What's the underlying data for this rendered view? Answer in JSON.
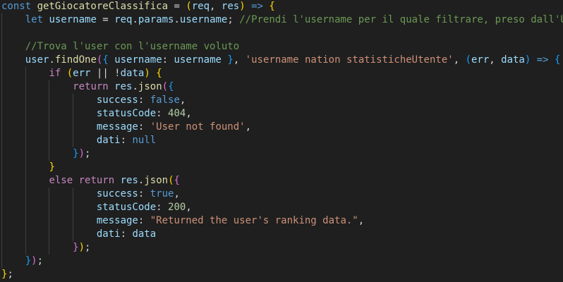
{
  "theme": {
    "background": "#1f1f1f",
    "indent_guide": "#404040"
  },
  "code_lines": [
    {
      "guides": 0,
      "tokens": [
        {
          "t": "const ",
          "c": "kw"
        },
        {
          "t": "getGiocatoreClassifica",
          "c": "fn"
        },
        {
          "t": " = ",
          "c": "plain"
        },
        {
          "t": "(",
          "c": "p1"
        },
        {
          "t": "req",
          "c": "var"
        },
        {
          "t": ", ",
          "c": "plain"
        },
        {
          "t": "res",
          "c": "var"
        },
        {
          "t": ")",
          "c": "p1"
        },
        {
          "t": " ",
          "c": "plain"
        },
        {
          "t": "=>",
          "c": "kw"
        },
        {
          "t": " ",
          "c": "plain"
        },
        {
          "t": "{",
          "c": "p1"
        }
      ]
    },
    {
      "guides": 1,
      "tokens": [
        {
          "t": "    ",
          "c": "plain"
        },
        {
          "t": "let ",
          "c": "kw"
        },
        {
          "t": "username",
          "c": "var"
        },
        {
          "t": " = ",
          "c": "plain"
        },
        {
          "t": "req",
          "c": "var"
        },
        {
          "t": ".",
          "c": "plain"
        },
        {
          "t": "params",
          "c": "var"
        },
        {
          "t": ".",
          "c": "plain"
        },
        {
          "t": "username",
          "c": "var"
        },
        {
          "t": "; ",
          "c": "plain"
        },
        {
          "t": "//Prendi l'username per il quale filtrare, preso dall'U",
          "c": "cmt"
        }
      ]
    },
    {
      "guides": 1,
      "tokens": []
    },
    {
      "guides": 1,
      "tokens": [
        {
          "t": "    ",
          "c": "plain"
        },
        {
          "t": "//Trova l'user con l'username voluto",
          "c": "cmt"
        }
      ]
    },
    {
      "guides": 1,
      "tokens": [
        {
          "t": "    ",
          "c": "plain"
        },
        {
          "t": "user",
          "c": "var"
        },
        {
          "t": ".",
          "c": "plain"
        },
        {
          "t": "findOne",
          "c": "fn"
        },
        {
          "t": "(",
          "c": "p2"
        },
        {
          "t": "{",
          "c": "p3"
        },
        {
          "t": " ",
          "c": "plain"
        },
        {
          "t": "username",
          "c": "var"
        },
        {
          "t": ": ",
          "c": "plain"
        },
        {
          "t": "username",
          "c": "var"
        },
        {
          "t": " ",
          "c": "plain"
        },
        {
          "t": "}",
          "c": "p3"
        },
        {
          "t": ", ",
          "c": "plain"
        },
        {
          "t": "'username nation statisticheUtente'",
          "c": "str"
        },
        {
          "t": ", ",
          "c": "plain"
        },
        {
          "t": "(",
          "c": "p3"
        },
        {
          "t": "err",
          "c": "var"
        },
        {
          "t": ", ",
          "c": "plain"
        },
        {
          "t": "data",
          "c": "var"
        },
        {
          "t": ")",
          "c": "p3"
        },
        {
          "t": " ",
          "c": "plain"
        },
        {
          "t": "=>",
          "c": "kw"
        },
        {
          "t": " ",
          "c": "plain"
        },
        {
          "t": "{",
          "c": "p3"
        }
      ]
    },
    {
      "guides": 2,
      "tokens": [
        {
          "t": "        ",
          "c": "plain"
        },
        {
          "t": "if",
          "c": "ctrl"
        },
        {
          "t": " ",
          "c": "plain"
        },
        {
          "t": "(",
          "c": "p1"
        },
        {
          "t": "err",
          "c": "var"
        },
        {
          "t": " || !",
          "c": "plain"
        },
        {
          "t": "data",
          "c": "var"
        },
        {
          "t": ")",
          "c": "p1"
        },
        {
          "t": " ",
          "c": "plain"
        },
        {
          "t": "{",
          "c": "p1"
        }
      ]
    },
    {
      "guides": 3,
      "tokens": [
        {
          "t": "            ",
          "c": "plain"
        },
        {
          "t": "return",
          "c": "ctrl"
        },
        {
          "t": " ",
          "c": "plain"
        },
        {
          "t": "res",
          "c": "var"
        },
        {
          "t": ".",
          "c": "plain"
        },
        {
          "t": "json",
          "c": "fn"
        },
        {
          "t": "(",
          "c": "p2"
        },
        {
          "t": "{",
          "c": "p3"
        }
      ]
    },
    {
      "guides": 4,
      "tokens": [
        {
          "t": "                ",
          "c": "plain"
        },
        {
          "t": "success",
          "c": "var"
        },
        {
          "t": ": ",
          "c": "plain"
        },
        {
          "t": "false",
          "c": "kw"
        },
        {
          "t": ",",
          "c": "plain"
        }
      ]
    },
    {
      "guides": 4,
      "tokens": [
        {
          "t": "                ",
          "c": "plain"
        },
        {
          "t": "statusCode",
          "c": "var"
        },
        {
          "t": ": ",
          "c": "plain"
        },
        {
          "t": "404",
          "c": "num"
        },
        {
          "t": ",",
          "c": "plain"
        }
      ]
    },
    {
      "guides": 4,
      "tokens": [
        {
          "t": "                ",
          "c": "plain"
        },
        {
          "t": "message",
          "c": "var"
        },
        {
          "t": ": ",
          "c": "plain"
        },
        {
          "t": "'User not found'",
          "c": "str"
        },
        {
          "t": ",",
          "c": "plain"
        }
      ]
    },
    {
      "guides": 4,
      "tokens": [
        {
          "t": "                ",
          "c": "plain"
        },
        {
          "t": "dati",
          "c": "var"
        },
        {
          "t": ": ",
          "c": "plain"
        },
        {
          "t": "null",
          "c": "kw"
        }
      ]
    },
    {
      "guides": 3,
      "tokens": [
        {
          "t": "            ",
          "c": "plain"
        },
        {
          "t": "}",
          "c": "p3"
        },
        {
          "t": ")",
          "c": "p2"
        },
        {
          "t": ";",
          "c": "plain"
        }
      ]
    },
    {
      "guides": 2,
      "tokens": [
        {
          "t": "        ",
          "c": "plain"
        },
        {
          "t": "}",
          "c": "p1"
        }
      ]
    },
    {
      "guides": 2,
      "tokens": [
        {
          "t": "        ",
          "c": "plain"
        },
        {
          "t": "else",
          "c": "ctrl"
        },
        {
          "t": " ",
          "c": "plain"
        },
        {
          "t": "return",
          "c": "ctrl"
        },
        {
          "t": " ",
          "c": "plain"
        },
        {
          "t": "res",
          "c": "var"
        },
        {
          "t": ".",
          "c": "plain"
        },
        {
          "t": "json",
          "c": "fn"
        },
        {
          "t": "(",
          "c": "p1"
        },
        {
          "t": "{",
          "c": "p2"
        }
      ]
    },
    {
      "guides": 4,
      "tokens": [
        {
          "t": "                ",
          "c": "plain"
        },
        {
          "t": "success",
          "c": "var"
        },
        {
          "t": ": ",
          "c": "plain"
        },
        {
          "t": "true",
          "c": "kw"
        },
        {
          "t": ",",
          "c": "plain"
        }
      ]
    },
    {
      "guides": 4,
      "tokens": [
        {
          "t": "                ",
          "c": "plain"
        },
        {
          "t": "statusCode",
          "c": "var"
        },
        {
          "t": ": ",
          "c": "plain"
        },
        {
          "t": "200",
          "c": "num"
        },
        {
          "t": ",",
          "c": "plain"
        }
      ]
    },
    {
      "guides": 4,
      "tokens": [
        {
          "t": "                ",
          "c": "plain"
        },
        {
          "t": "message",
          "c": "var"
        },
        {
          "t": ": ",
          "c": "plain"
        },
        {
          "t": "\"Returned the user's ranking data.\"",
          "c": "str"
        },
        {
          "t": ",",
          "c": "plain"
        }
      ]
    },
    {
      "guides": 4,
      "tokens": [
        {
          "t": "                ",
          "c": "plain"
        },
        {
          "t": "dati",
          "c": "var"
        },
        {
          "t": ": ",
          "c": "plain"
        },
        {
          "t": "data",
          "c": "var"
        }
      ]
    },
    {
      "guides": 3,
      "tokens": [
        {
          "t": "            ",
          "c": "plain"
        },
        {
          "t": "}",
          "c": "p2"
        },
        {
          "t": ")",
          "c": "p1"
        },
        {
          "t": ";",
          "c": "plain"
        }
      ]
    },
    {
      "guides": 1,
      "tokens": [
        {
          "t": "    ",
          "c": "plain"
        },
        {
          "t": "}",
          "c": "p3"
        },
        {
          "t": ")",
          "c": "p2"
        },
        {
          "t": ";",
          "c": "plain"
        }
      ]
    },
    {
      "guides": 0,
      "tokens": [
        {
          "t": "}",
          "c": "p1"
        },
        {
          "t": ";",
          "c": "plain"
        }
      ]
    }
  ]
}
